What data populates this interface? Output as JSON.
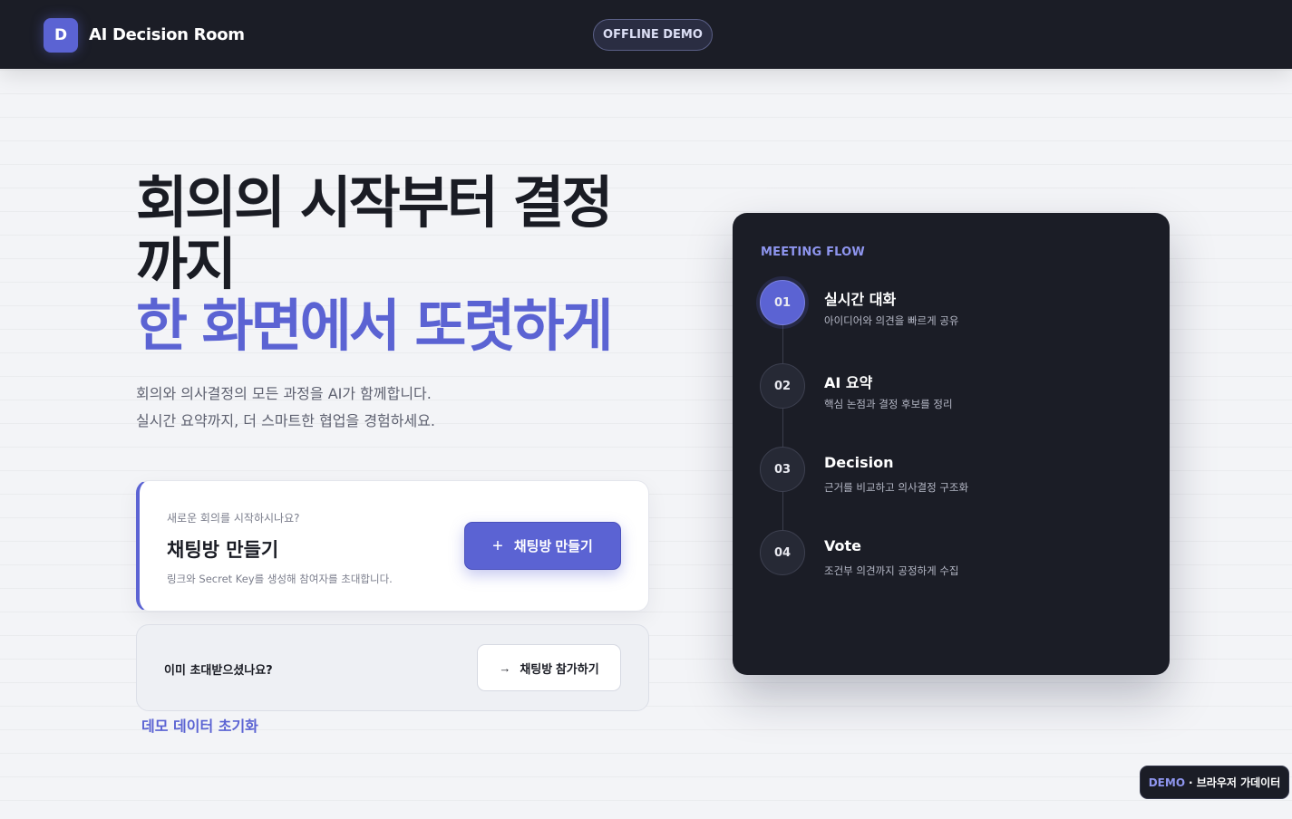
{
  "header": {
    "logo_letter": "D",
    "app_title": "AI Decision Room",
    "mode_badge": "OFFLINE DEMO"
  },
  "hero": {
    "title_line1": "회의의 시작부터 결정까지",
    "title_accent": "한 화면에서 또렷하게",
    "desc_line1": "회의와 의사결정의 모든 과정을 AI가 함께합니다.",
    "desc_line2": "실시간 요약까지, 더 스마트한 협업을 경험하세요."
  },
  "create_card": {
    "eyebrow": "새로운 회의를 시작하시나요?",
    "title": "채팅방 만들기",
    "subtitle": "링크와 Secret Key를 생성해 참여자를 초대합니다.",
    "button_icon": "+",
    "button_label": "채팅방 만들기"
  },
  "join_card": {
    "label": "이미 초대받으셨나요?",
    "button_icon": "→",
    "button_label": "채팅방 참가하기"
  },
  "reset_link": "데모 데이터 초기화",
  "flow": {
    "eyebrow": "MEETING FLOW",
    "steps": [
      {
        "num": "01",
        "title": "실시간 대화",
        "desc": "아이디어와 의견을 빠르게 공유",
        "active": true
      },
      {
        "num": "02",
        "title": "AI 요약",
        "desc": "핵심 논점과 결정 후보를 정리",
        "active": false
      },
      {
        "num": "03",
        "title": "Decision",
        "desc": "근거를 비교하고 의사결정 구조화",
        "active": false
      },
      {
        "num": "04",
        "title": "Vote",
        "desc": "조건부 의견까지 공정하게 수집",
        "active": false
      }
    ]
  },
  "demo_badge": {
    "tag": "DEMO",
    "text": "· 브라우저 가데이터"
  },
  "colors": {
    "accent": "#5b63d3",
    "dark": "#1b1d26",
    "background": "#f3f4f7"
  }
}
